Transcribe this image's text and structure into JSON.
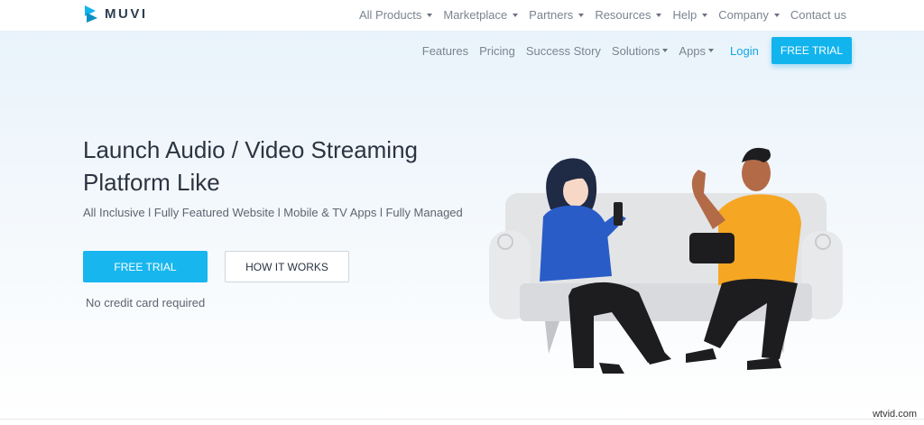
{
  "brand": {
    "name": "MUVI",
    "color": "#12b4ee"
  },
  "topnav": {
    "items": [
      {
        "label": "All Products",
        "dropdown": true
      },
      {
        "label": "Marketplace",
        "dropdown": true
      },
      {
        "label": "Partners",
        "dropdown": true
      },
      {
        "label": "Resources",
        "dropdown": true
      },
      {
        "label": "Help",
        "dropdown": true
      },
      {
        "label": "Company",
        "dropdown": true
      },
      {
        "label": "Contact us",
        "dropdown": false
      }
    ]
  },
  "subnav": {
    "items": [
      {
        "label": "Features",
        "dropdown": false
      },
      {
        "label": "Pricing",
        "dropdown": false
      },
      {
        "label": "Success Story",
        "dropdown": false
      },
      {
        "label": "Solutions",
        "dropdown": true
      },
      {
        "label": "Apps",
        "dropdown": true
      }
    ],
    "login": "Login",
    "trial": "FREE TRIAL"
  },
  "hero": {
    "headline": "Launch Audio / Video Streaming Platform Like",
    "tagline": "All Inclusive l Fully Featured Website l Mobile & TV Apps l Fully Managed",
    "primary_button": "FREE TRIAL",
    "secondary_button": "HOW IT WORKS",
    "note": "No credit card required"
  },
  "illustration": {
    "icon": "people-on-couch-illustration"
  },
  "watermark": "wtvid.com"
}
